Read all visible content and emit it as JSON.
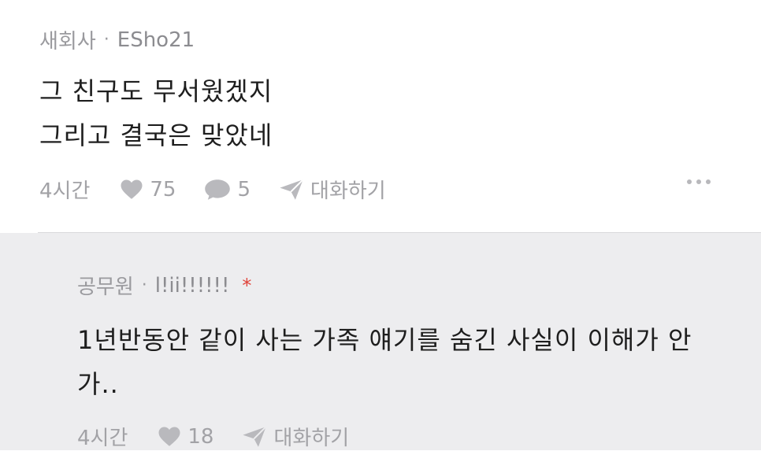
{
  "comment1": {
    "category": "새회사",
    "separator": "·",
    "nickname": "ESho21",
    "lines": [
      "그 친구도 무서웠겠지",
      "그리고 결국은 맞았네"
    ],
    "time": "4시간",
    "likes": "75",
    "replies": "5",
    "talk_label": "대화하기"
  },
  "comment2": {
    "category": "공무원",
    "separator": "·",
    "nickname": "l!ii!!!!!!",
    "badge": "*",
    "lines": [
      "1년반동안 같이 사는 가족 얘기를 숨긴 사실이 이해가 안",
      "가.."
    ],
    "time": "4시간",
    "likes": "18",
    "talk_label": "대화하기"
  },
  "colors": {
    "muted": "#9a9a9e",
    "reply_bg": "#ededef",
    "badge": "#e0433a"
  },
  "icons": [
    "heart-icon",
    "comment-bubble-icon",
    "paper-plane-icon",
    "more-dots-icon"
  ]
}
